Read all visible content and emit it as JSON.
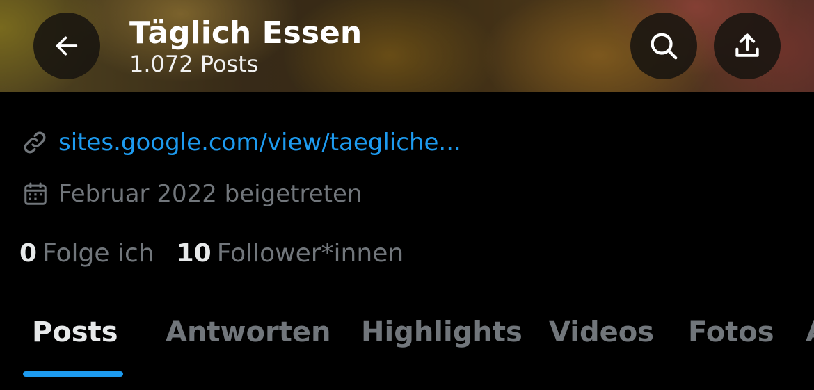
{
  "header": {
    "name": "Täglich Essen",
    "posts_count": "1.072 Posts"
  },
  "profile": {
    "link": "sites.google.com/view/taegliche...",
    "joined": "Februar 2022 beigetreten",
    "following_count": "0",
    "following_label": "Folge ich",
    "followers_count": "10",
    "followers_label": "Follower*innen"
  },
  "tabs": [
    {
      "label": "Posts",
      "active": true
    },
    {
      "label": "Antworten",
      "active": false
    },
    {
      "label": "Highlights",
      "active": false
    },
    {
      "label": "Videos",
      "active": false
    },
    {
      "label": "Fotos",
      "active": false
    },
    {
      "label": "A",
      "active": false
    }
  ],
  "icons": {
    "back": "arrow-left-icon",
    "search": "search-icon",
    "share": "share-icon",
    "link": "link-icon",
    "calendar": "calendar-icon"
  },
  "colors": {
    "accent": "#1d9bf0",
    "muted_text": "#71767b",
    "primary_text": "#e7e9ea",
    "background": "#000000"
  }
}
